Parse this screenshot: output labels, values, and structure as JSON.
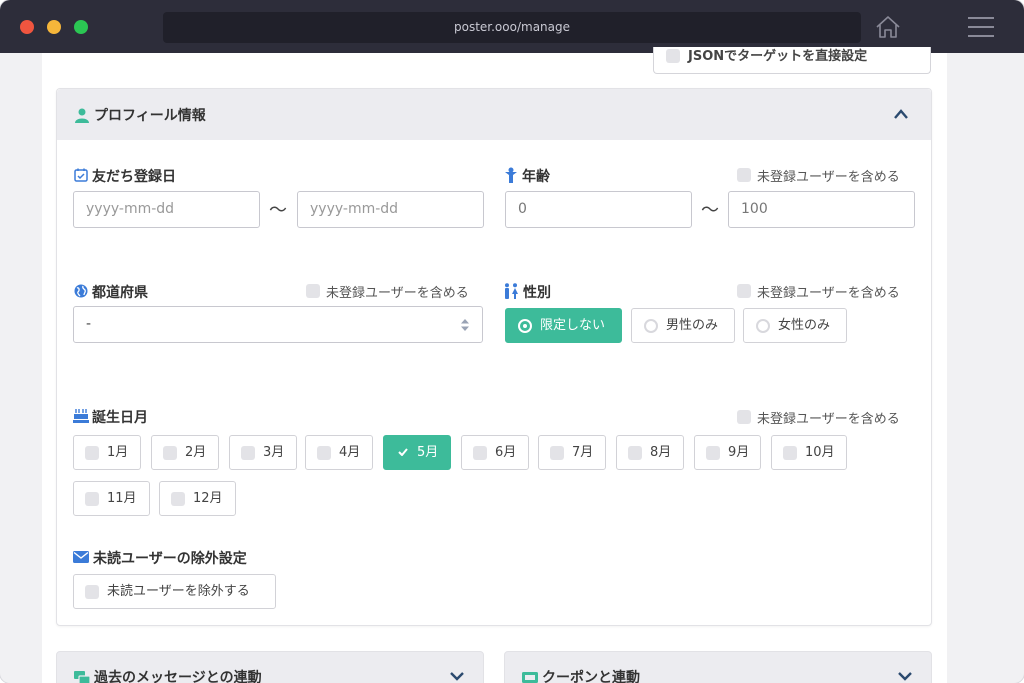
{
  "browser": {
    "url": "poster.ooo/manage"
  },
  "top_button": {
    "label": "JSONでターゲットを直接設定"
  },
  "profile_panel": {
    "title": "プロフィール情報"
  },
  "friend_date": {
    "label": "友だち登録日",
    "from_placeholder": "yyyy-mm-dd",
    "to_placeholder": "yyyy-mm-dd",
    "separator": "〜"
  },
  "age": {
    "label": "年齢",
    "include_unregistered": "未登録ユーザーを含める",
    "min_value": "0",
    "max_value": "100",
    "separator": "〜"
  },
  "prefecture": {
    "label": "都道府県",
    "include_unregistered": "未登録ユーザーを含める",
    "selected": "-"
  },
  "gender": {
    "label": "性別",
    "include_unregistered": "未登録ユーザーを含める",
    "options": [
      {
        "label": "限定しない",
        "selected": true
      },
      {
        "label": "男性のみ",
        "selected": false
      },
      {
        "label": "女性のみ",
        "selected": false
      }
    ]
  },
  "birth_month": {
    "label": "誕生日月",
    "include_unregistered": "未登録ユーザーを含める",
    "months": [
      {
        "label": "1月",
        "checked": false
      },
      {
        "label": "2月",
        "checked": false
      },
      {
        "label": "3月",
        "checked": false
      },
      {
        "label": "4月",
        "checked": false
      },
      {
        "label": "5月",
        "checked": true
      },
      {
        "label": "6月",
        "checked": false
      },
      {
        "label": "7月",
        "checked": false
      },
      {
        "label": "8月",
        "checked": false
      },
      {
        "label": "9月",
        "checked": false
      },
      {
        "label": "10月",
        "checked": false
      },
      {
        "label": "11月",
        "checked": false
      },
      {
        "label": "12月",
        "checked": false
      }
    ]
  },
  "unread_exclusion": {
    "label": "未読ユーザーの除外設定",
    "checkbox_label": "未読ユーザーを除外する"
  },
  "past_messages_panel": {
    "title": "過去のメッセージとの連動"
  },
  "coupon_panel": {
    "title": "クーポンと連動"
  },
  "colors": {
    "accent": "#3dbb9a",
    "titlebar": "#2d2d3a",
    "icon_blue": "#3b7bd8"
  }
}
